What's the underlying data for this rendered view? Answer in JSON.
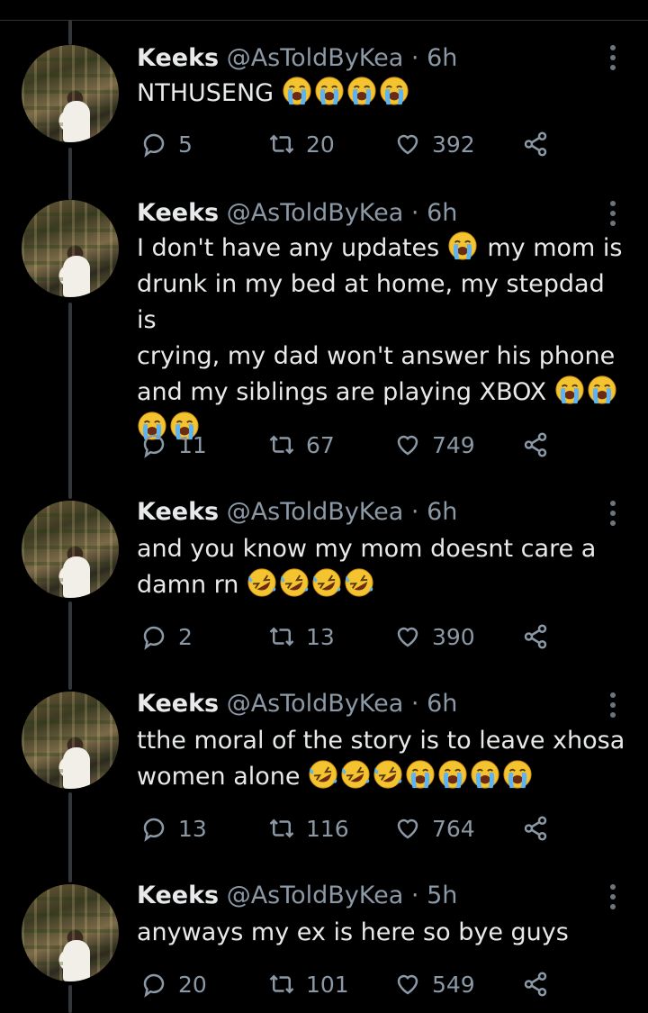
{
  "tweets": [
    {
      "name": "Keeks",
      "meta": "@AsToldByKea · 6h",
      "lines": [
        "NTHUSENG"
      ],
      "emoji_rows": [
        [
          "crying-face",
          "crying-face",
          "crying-face",
          "crying-face"
        ]
      ],
      "replies": "5",
      "retweets": "20",
      "likes": "392"
    },
    {
      "name": "Keeks",
      "meta": "@AsToldByKea · 6h",
      "text_a": "I don't have any updates",
      "text_b": "my mom is",
      "lines": [
        "drunk in my bed at home, my stepdad is",
        "crying, my dad won't answer his phone",
        "and my siblings are playing XBOX"
      ],
      "replies": "11",
      "retweets": "67",
      "likes": "749"
    },
    {
      "name": "Keeks",
      "meta": "@AsToldByKea · 6h",
      "lines": [
        "and you know my mom doesnt care a",
        "damn rn"
      ],
      "replies": "2",
      "retweets": "13",
      "likes": "390"
    },
    {
      "name": "Keeks",
      "meta": "@AsToldByKea · 6h",
      "lines": [
        "tthe moral of the story is to leave xhosa",
        "women alone"
      ],
      "replies": "13",
      "retweets": "116",
      "likes": "764"
    },
    {
      "name": "Keeks",
      "meta": "@AsToldByKea · 5h",
      "lines": [
        "anyways my ex is here so bye guys"
      ],
      "replies": "20",
      "retweets": "101",
      "likes": "549"
    }
  ],
  "colors": {
    "background": "#000000",
    "text": "#e7e9ea",
    "muted": "#8b98a5",
    "emoji": "#f4c430"
  }
}
